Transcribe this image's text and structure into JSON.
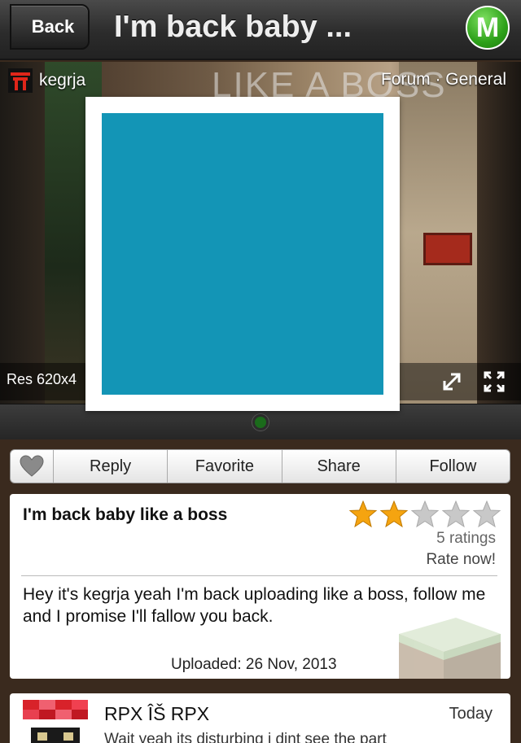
{
  "header": {
    "back_label": "Back",
    "title": "I'm back baby ...",
    "logo_letter": "M"
  },
  "media": {
    "user_name": "kegrja",
    "forum_label": "Forum · General",
    "resolution_label": "Res 620x4",
    "background_text": "LIKE A BOSS"
  },
  "popup": {
    "swatch_color": "#1395b6"
  },
  "actions": {
    "heart_icon": "heart-icon",
    "reply": "Reply",
    "favorite": "Favorite",
    "share": "Share",
    "follow": "Follow"
  },
  "post": {
    "title": "I'm back baby like a boss",
    "rating": {
      "value": 2,
      "max": 5
    },
    "ratings_count": "5 ratings",
    "rate_now": "Rate now!",
    "body": "Hey it's kegrja yeah I'm back uploading like a boss, follow me and I promise I'll fallow you back.",
    "uploaded": "Uploaded: 26 Nov, 2013"
  },
  "comment": {
    "author": "RPX ÎŠ RPX",
    "time": "Today",
    "text": "Wait yeah its disturbing i dint see the part"
  },
  "colors": {
    "star_on": "#f5a410",
    "star_off": "#c8c8c8",
    "logo_green": "#2ea11a",
    "pager_dot": "#1b6b1b"
  }
}
